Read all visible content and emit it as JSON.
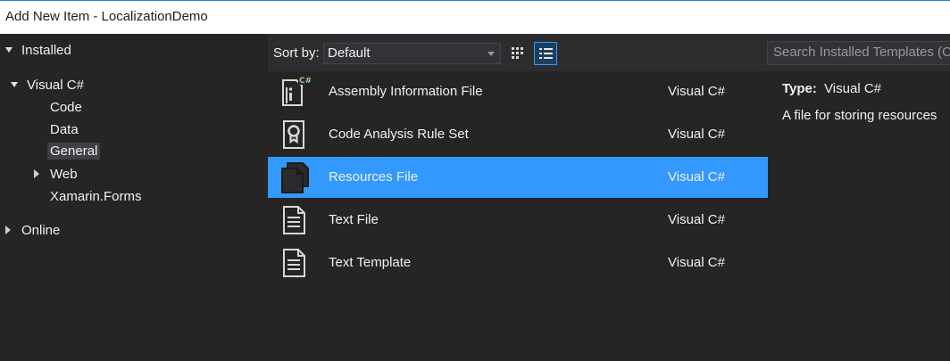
{
  "window": {
    "title": "Add New Item - LocalizationDemo"
  },
  "tree": {
    "installed": "Installed",
    "visual_csharp": "Visual C#",
    "children": [
      "Code",
      "Data",
      "General",
      "Web",
      "Xamarin.Forms"
    ],
    "selected": "General",
    "online": "Online"
  },
  "toolbar": {
    "sort_label": "Sort by:",
    "sort_value": "Default",
    "search_placeholder": "Search Installed Templates (Ct"
  },
  "templates": [
    {
      "name": "Assembly Information File",
      "lang": "Visual C#",
      "icon": "assembly-info-icon",
      "badge": "C#"
    },
    {
      "name": "Code Analysis Rule Set",
      "lang": "Visual C#",
      "icon": "rule-set-icon"
    },
    {
      "name": "Resources File",
      "lang": "Visual C#",
      "icon": "resources-file-icon",
      "selected": true
    },
    {
      "name": "Text File",
      "lang": "Visual C#",
      "icon": "text-file-icon"
    },
    {
      "name": "Text Template",
      "lang": "Visual C#",
      "icon": "text-template-icon"
    }
  ],
  "details": {
    "type_label": "Type:",
    "type_value": "Visual C#",
    "description": "A file for storing resources"
  },
  "colors": {
    "accent": "#3399ff",
    "background": "#252526",
    "toolbar": "#2d2d30",
    "titlebar": "#ffffff"
  }
}
